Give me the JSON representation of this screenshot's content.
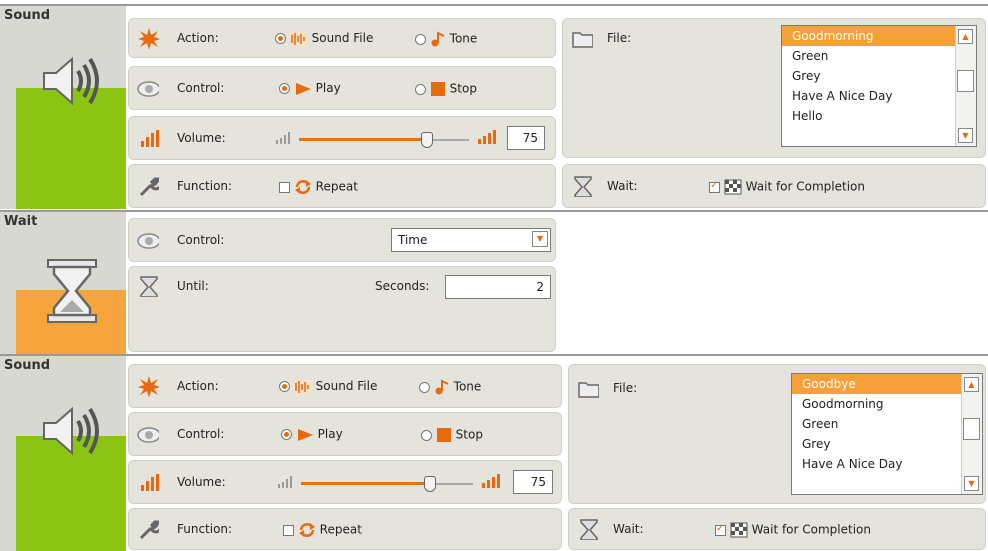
{
  "blocks": [
    {
      "title": "Sound",
      "labels": {
        "action": "Action:",
        "control": "Control:",
        "volume": "Volume:",
        "function": "Function:",
        "file": "File:",
        "wait": "Wait:"
      },
      "action_options": [
        "Sound File",
        "Tone"
      ],
      "action_selected": "Sound File",
      "control_options": [
        "Play",
        "Stop"
      ],
      "control_selected": "Play",
      "volume": "75",
      "volume_level": 0.75,
      "repeat_label": "Repeat",
      "repeat_checked": false,
      "files": [
        "Goodmorning",
        "Green",
        "Grey",
        "Have A Nice Day",
        "Hello"
      ],
      "file_selected": "Goodmorning",
      "wait_label": "Wait for Completion",
      "wait_checked": true
    },
    {
      "title": "Wait",
      "labels": {
        "control": "Control:",
        "until": "Until:",
        "seconds": "Seconds:"
      },
      "control_value": "Time",
      "seconds": "2"
    },
    {
      "title": "Sound",
      "labels": {
        "action": "Action:",
        "control": "Control:",
        "volume": "Volume:",
        "function": "Function:",
        "file": "File:",
        "wait": "Wait:"
      },
      "action_options": [
        "Sound File",
        "Tone"
      ],
      "action_selected": "Sound File",
      "control_options": [
        "Play",
        "Stop"
      ],
      "control_selected": "Play",
      "volume": "75",
      "volume_level": 0.75,
      "repeat_label": "Repeat",
      "repeat_checked": false,
      "files": [
        "Goodbye",
        "Goodmorning",
        "Green",
        "Grey",
        "Have A Nice Day"
      ],
      "file_selected": "Goodbye",
      "wait_label": "Wait for Completion",
      "wait_checked": true
    }
  ],
  "colors": {
    "sound_accent": "#8cc414",
    "wait_accent": "#f6a53c",
    "orange": "#e86a0c"
  }
}
